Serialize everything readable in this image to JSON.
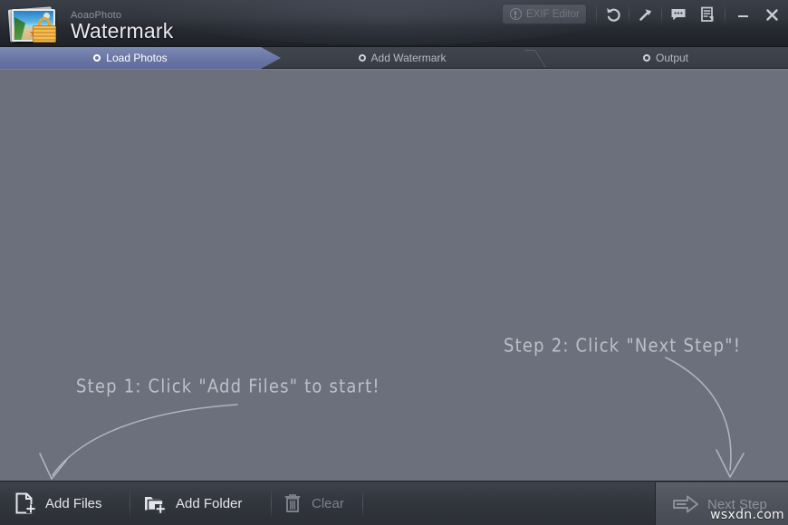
{
  "window": {
    "app_subtitle": "AoaoPhoto",
    "app_title": "Watermark",
    "logo_icon": "photo-lock-icon",
    "toolbar": {
      "exif_label": "EXIF Editor",
      "exif_icon": "info-circle-icon",
      "undo_icon": "undo-arrow-icon",
      "tools_icon": "wrench-icon",
      "feedback_icon": "speech-bubble-icon",
      "register_icon": "document-register-icon",
      "minimize_icon": "minimize-icon",
      "close_icon": "close-icon"
    }
  },
  "steps": [
    {
      "label": "Load Photos",
      "icon": "step-circle-icon",
      "active": true
    },
    {
      "label": "Add Watermark",
      "icon": "step-circle-icon",
      "active": false
    },
    {
      "label": "Output",
      "icon": "step-circle-icon",
      "active": false
    }
  ],
  "canvas": {
    "hints": [
      {
        "text": "Step 1: Click \"Add Files\" to start!"
      },
      {
        "text": "Step 2: Click \"Next Step\"!"
      }
    ],
    "arrow_1_name": "hint-arrow-to-add-files",
    "arrow_2_name": "hint-arrow-to-next-step"
  },
  "bottombar": {
    "add_files": {
      "label": "Add Files",
      "icon": "file-plus-icon",
      "enabled": true
    },
    "add_folder": {
      "label": "Add Folder",
      "icon": "folder-plus-icon",
      "enabled": true
    },
    "clear": {
      "label": "Clear",
      "icon": "trash-icon",
      "enabled": false
    },
    "next_step": {
      "label": "Next Step",
      "icon": "arrow-right-icon",
      "enabled": false
    }
  },
  "overlay": {
    "watermark_text": "wsxdn.com"
  },
  "colors": {
    "canvas_bg": "#6b707c",
    "titlebar_bg": "#32363e",
    "active_step": "#6b78a6",
    "bottombar_bg": "#33363e",
    "accent_lock": "#e0a23c"
  }
}
